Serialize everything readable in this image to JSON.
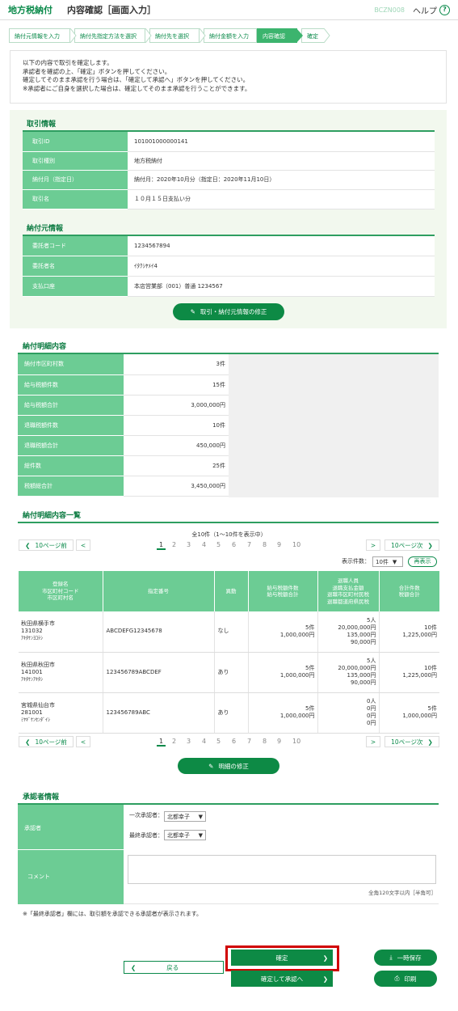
{
  "header": {
    "app": "地方税納付",
    "title": "内容確認［画面入力］",
    "code": "BCZN008",
    "help": "ヘルプ",
    "help_icon": "?"
  },
  "steps": [
    "納付元情報を入力",
    "納付先指定方法を選択",
    "納付先を選択",
    "納付金額を入力",
    "内容確認",
    "確定"
  ],
  "info": [
    "以下の内容で取引を確定します。",
    "承認者を確認の上、「確定」ボタンを押してください。",
    "確定してそのまま承認を行う場合は、「確定して承認へ」ボタンを押してください。",
    "※承認者にご自身を選択した場合は、確定してそのまま承認を行うことができます。"
  ],
  "torihiki": {
    "title": "取引情報",
    "rows": [
      [
        "取引ID",
        "101001000000141"
      ],
      [
        "取引種別",
        "地方税納付"
      ],
      [
        "納付月（指定日）",
        "納付月：2020年10月分（指定日：2020年11月10日）"
      ],
      [
        "取引名",
        "１０月１５日支払い分"
      ]
    ]
  },
  "nofumoto": {
    "title": "納付元情報",
    "rows": [
      [
        "委託者コード",
        "1234567894"
      ],
      [
        "委託者名",
        "ｲﾀｸｼﾔﾒｲ4"
      ],
      [
        "支払口座",
        "本店営業部（001）普通 1234567"
      ]
    ]
  },
  "edit1": "取引・納付元情報の修正",
  "meisai": {
    "title": "納付明細内容",
    "rows": [
      [
        "納付市区町村数",
        "3件"
      ],
      [
        "給与税額件数",
        "15件"
      ],
      [
        "給与税額合計",
        "3,000,000円"
      ],
      [
        "退職税額件数",
        "10件"
      ],
      [
        "退職税額合計",
        "450,000円"
      ],
      [
        "総件数",
        "25件"
      ],
      [
        "税額総合計",
        "3,450,000円"
      ]
    ]
  },
  "list": {
    "title": "納付明細内容一覧",
    "count": "全10件（1～10件を表示中）",
    "prev10": "10ページ前",
    "next10": "10ページ次",
    "prev": "<",
    "next": ">",
    "pages": [
      "1",
      "2",
      "3",
      "4",
      "5",
      "6",
      "7",
      "8",
      "9",
      "10"
    ],
    "per_page_label": "表示件数：",
    "per_page": "10件",
    "redisplay": "再表示",
    "headers": [
      [
        "登録名",
        "市区町村コード",
        "市区町村名"
      ],
      [
        "指定番号"
      ],
      [
        "異動"
      ],
      [
        "給与税額件数",
        "給与税額合計"
      ],
      [
        "退職人員",
        "退職支払金額",
        "退職市区町村民税",
        "退職都道府県民税"
      ],
      [
        "合計件数",
        "税額合計"
      ]
    ],
    "rows": [
      {
        "name": [
          "秋田県横手市",
          "131032",
          "ｱｷﾀｹﾝﾖｺﾃｼ"
        ],
        "no": "ABCDEFG12345678",
        "ido": "なし",
        "kyu": [
          "5件",
          "1,000,000円"
        ],
        "tai": [
          "5人",
          "20,000,000円",
          "135,000円",
          "90,000円"
        ],
        "tot": [
          "10件",
          "1,225,000円"
        ]
      },
      {
        "name": [
          "秋田県秋田市",
          "141001",
          "ｱｷﾀｹﾝｱｷﾀｼ"
        ],
        "no": "123456789ABCDEF",
        "ido": "あり",
        "kyu": [
          "5件",
          "1,000,000円"
        ],
        "tai": [
          "5人",
          "20,000,000円",
          "135,000円",
          "90,000円"
        ],
        "tot": [
          "10件",
          "1,225,000円"
        ]
      },
      {
        "name": [
          "宮城県仙台市",
          "281001",
          "ﾐﾔｷﾞｹﾝｾﾝﾀﾞｲｼ"
        ],
        "no": "123456789ABC",
        "ido": "あり",
        "kyu": [
          "5件",
          "1,000,000円"
        ],
        "tai": [
          "0人",
          "0円",
          "0円",
          "0円"
        ],
        "tot": [
          "5件",
          "1,000,000円"
        ]
      }
    ]
  },
  "edit2": "明細の修正",
  "approver": {
    "title": "承認者情報",
    "label": "承認者",
    "first_label": "一次承認者：",
    "first": "北都幸子",
    "final_label": "最終承認者：",
    "final": "北都幸子",
    "comment_label": "コメント",
    "comment_note": "全角120文字以内［半角可］",
    "note": "※「最終承認者」欄には、取引額を承認できる承認者が表示されます。"
  },
  "buttons": {
    "back": "戻る",
    "confirm": "確定",
    "confirm_approve": "確定して承認へ",
    "save": "一時保存",
    "print": "印刷"
  },
  "colors": {
    "brand": "#0a8a4a",
    "label_bg": "#6ccc94",
    "highlight": "#d00000"
  }
}
